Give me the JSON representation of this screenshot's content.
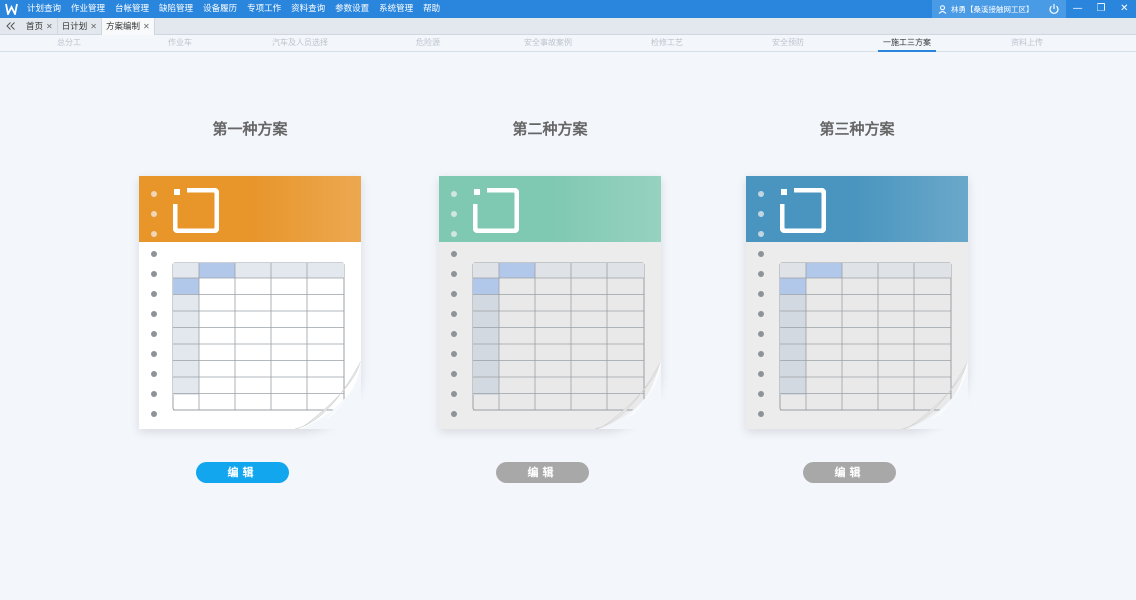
{
  "app": {
    "menu": [
      "计划查询",
      "作业管理",
      "台帐管理",
      "缺陷管理",
      "设备履历",
      "专项工作",
      "资料查询",
      "参数设置",
      "系统管理",
      "帮助"
    ],
    "user": "林勇【桑溪接触网工区】"
  },
  "tabs": [
    {
      "label": "首页",
      "active": false
    },
    {
      "label": "日计划",
      "active": false
    },
    {
      "label": "方案编制",
      "active": true
    }
  ],
  "subnav": [
    {
      "label": "总分工",
      "active": false
    },
    {
      "label": "作业车",
      "active": false
    },
    {
      "label": "汽车及人员选择",
      "active": false
    },
    {
      "label": "危险源",
      "active": false
    },
    {
      "label": "安全事故案例",
      "active": false
    },
    {
      "label": "检修工艺",
      "active": false
    },
    {
      "label": "安全预防",
      "active": false
    },
    {
      "label": "一施工三方案",
      "active": true
    },
    {
      "label": "资料上传",
      "active": false
    }
  ],
  "plans": [
    {
      "title": "第一种方案",
      "button": "编辑",
      "header_color": "#e8952a",
      "body_color": "#ffffff",
      "button_color": "#11a6ee",
      "active": true
    },
    {
      "title": "第二种方案",
      "button": "编辑",
      "header_color": "#7fc8b2",
      "body_color": "#ececec",
      "button_color": "#a8a8a8",
      "active": false
    },
    {
      "title": "第三种方案",
      "button": "编辑",
      "header_color": "#4a95bf",
      "body_color": "#ececec",
      "button_color": "#a8a8a8",
      "active": false
    }
  ],
  "colors": {
    "accent": "#2a86dd"
  }
}
